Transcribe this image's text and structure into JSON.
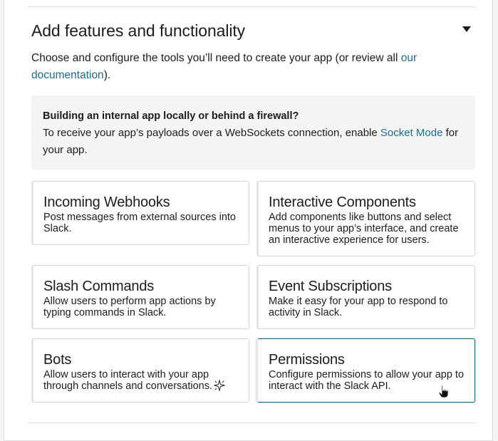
{
  "section": {
    "title": "Add features and functionality",
    "intro_text": "Choose and configure the tools you’ll need to create your app (or review all ",
    "intro_link": "our documentation",
    "intro_end": ").",
    "collapse_icon": "caret-down-icon"
  },
  "callout": {
    "title": "Building an internal app locally or behind a firewall?",
    "body_start": "To receive your app’s payloads over a WebSockets connection, enable ",
    "body_link": "Socket Mode",
    "body_end": " for your app."
  },
  "features": [
    {
      "title": "Incoming Webhooks",
      "description": "Post messages from external sources into Slack."
    },
    {
      "title": "Interactive Components",
      "description": "Add components like buttons and select menus to your app’s interface, and create an interactive experience for users."
    },
    {
      "title": "Slash Commands",
      "description": "Allow users to perform app actions by typing commands in Slack."
    },
    {
      "title": "Event Subscriptions",
      "description": "Make it easy for your app to respond to activity in Slack."
    },
    {
      "title": "Bots",
      "description": "Allow users to interact with your app through channels and conversations."
    },
    {
      "title": "Permissions",
      "description": "Configure permissions to allow your app to interact with the Slack API."
    }
  ],
  "colors": {
    "link": "#1d6c89",
    "text": "#1d1c1d",
    "callout_bg": "#f3f4f4",
    "active_border": "#1d6c89"
  },
  "icons": {
    "sparkle": "sparkle-icon",
    "cursor": "hand-cursor-icon"
  }
}
